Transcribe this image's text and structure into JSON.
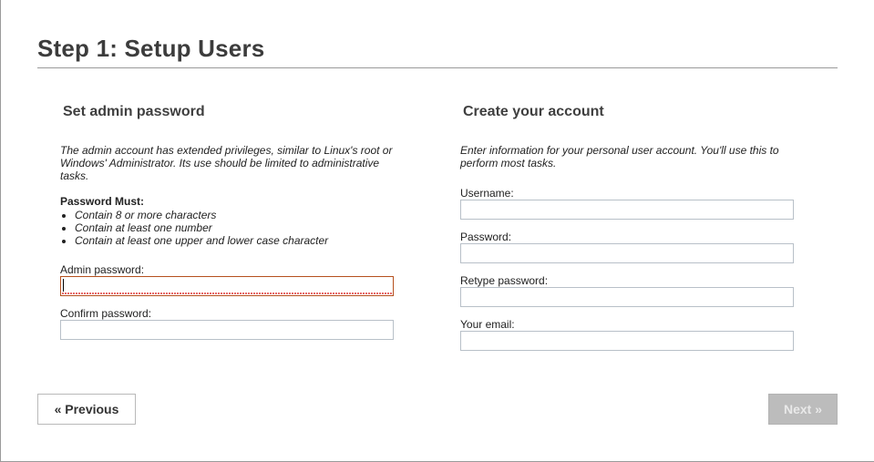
{
  "page": {
    "title": "Step 1: Setup Users"
  },
  "admin": {
    "heading": "Set admin password",
    "description": "The admin account has extended privileges, similar to Linux's root or Windows' Administrator. Its use should be limited to administrative tasks.",
    "must_title": "Password Must:",
    "rules": [
      "Contain 8 or more characters",
      "Contain at least one number",
      "Contain at least one upper and lower case character"
    ],
    "password_label": "Admin password:",
    "password_value": "",
    "confirm_label": "Confirm password:",
    "confirm_value": ""
  },
  "account": {
    "heading": "Create your account",
    "description": "Enter information for your personal user account. You'll use this to perform most tasks.",
    "username_label": "Username:",
    "username_value": "",
    "password_label": "Password:",
    "password_value": "",
    "retype_label": "Retype password:",
    "retype_value": "",
    "email_label": "Your email:",
    "email_value": ""
  },
  "nav": {
    "previous_label": "« Previous",
    "next_label": "Next »",
    "next_enabled": false
  },
  "colors": {
    "title": "#3c3c3c",
    "invalid_border": "#b5501e",
    "disabled_button": "#bcbcbc"
  }
}
